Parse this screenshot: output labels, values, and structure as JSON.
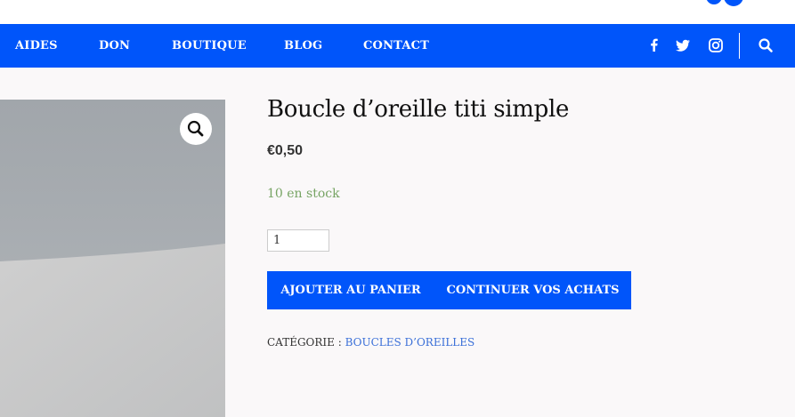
{
  "nav": {
    "items": [
      {
        "label": "AIDES"
      },
      {
        "label": "DON"
      },
      {
        "label": "BOUTIQUE"
      },
      {
        "label": "BLOG"
      },
      {
        "label": "CONTACT"
      }
    ],
    "icons": [
      "facebook-icon",
      "twitter-icon",
      "instagram-icon",
      "search-icon"
    ]
  },
  "product": {
    "title": "Boucle d’oreille titi simple",
    "price": "€0,50",
    "stock": "10 en stock",
    "quantity": "1",
    "add_to_cart_label": "AJOUTER AU PANIER",
    "continue_label": "CONTINUER VOS ACHATS",
    "category_label": "CATÉGORIE : ",
    "category_link": "BOUCLES D’OREILLES"
  },
  "colors": {
    "brand": "#0055fa",
    "stock": "#77a464",
    "link": "#3a6fd8"
  }
}
